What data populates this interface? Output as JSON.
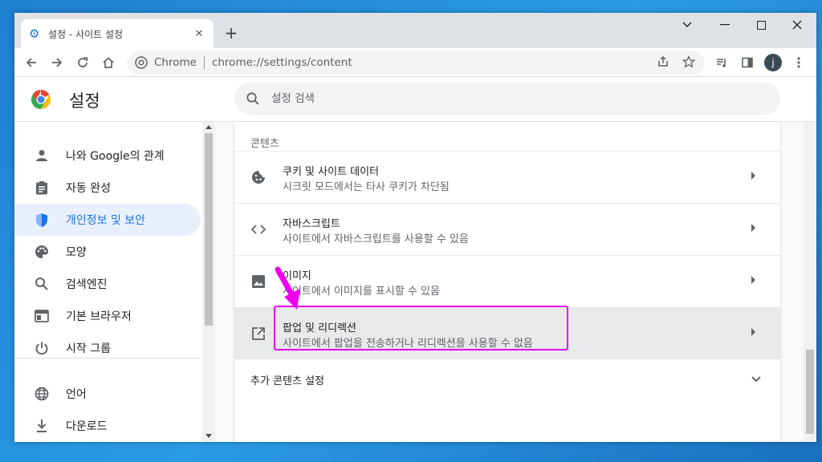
{
  "tab": {
    "title": "설정 - 사이트 설정",
    "close": "✕",
    "new_tab": "+"
  },
  "window_controls": {
    "chevron": "⌄",
    "minimize": "—",
    "close": "✕"
  },
  "toolbar": {
    "back_icon": "arrow-left-icon",
    "forward_icon": "arrow-right-icon",
    "reload_icon": "reload-icon",
    "home_icon": "home-icon",
    "site_label": "Chrome",
    "url": "chrome://settings/content",
    "avatar_letter": "j"
  },
  "header": {
    "title": "설정",
    "search_placeholder": "설정 검색"
  },
  "sidebar": {
    "items": [
      {
        "label": "나와 Google의 관계",
        "icon": "person-icon"
      },
      {
        "label": "자동 완성",
        "icon": "clipboard-icon"
      },
      {
        "label": "개인정보 및 보안",
        "icon": "shield-icon",
        "active": true
      },
      {
        "label": "모양",
        "icon": "palette-icon"
      },
      {
        "label": "검색엔진",
        "icon": "search-icon"
      },
      {
        "label": "기본 브라우저",
        "icon": "browser-icon"
      },
      {
        "label": "시작 그룹",
        "icon": "power-icon"
      },
      {
        "label": "언어",
        "icon": "globe-icon"
      },
      {
        "label": "다운로드",
        "icon": "download-icon"
      }
    ]
  },
  "content": {
    "section_title": "콘텐츠",
    "rows": [
      {
        "title": "쿠키 및 사이트 데이터",
        "subtitle": "시크릿 모드에서는 타사 쿠키가 차단됨",
        "icon": "cookie-icon"
      },
      {
        "title": "자바스크립트",
        "subtitle": "사이트에서 자바스크립트를 사용할 수 있음",
        "icon": "code-icon"
      },
      {
        "title": "이미지",
        "subtitle": "사이트에서 이미지를 표시할 수 있음",
        "icon": "image-icon"
      },
      {
        "title": "팝업 및 리디렉션",
        "subtitle": "사이트에서 팝업을 전송하거나 리디렉션을 사용할 수 없음",
        "icon": "open-in-new-icon",
        "highlighted": true
      }
    ],
    "more_settings": "추가 콘텐츠 설정"
  },
  "colors": {
    "accent": "#1a73e8",
    "annotation": "#ee00ee",
    "active_bg": "#e8f0fe"
  }
}
